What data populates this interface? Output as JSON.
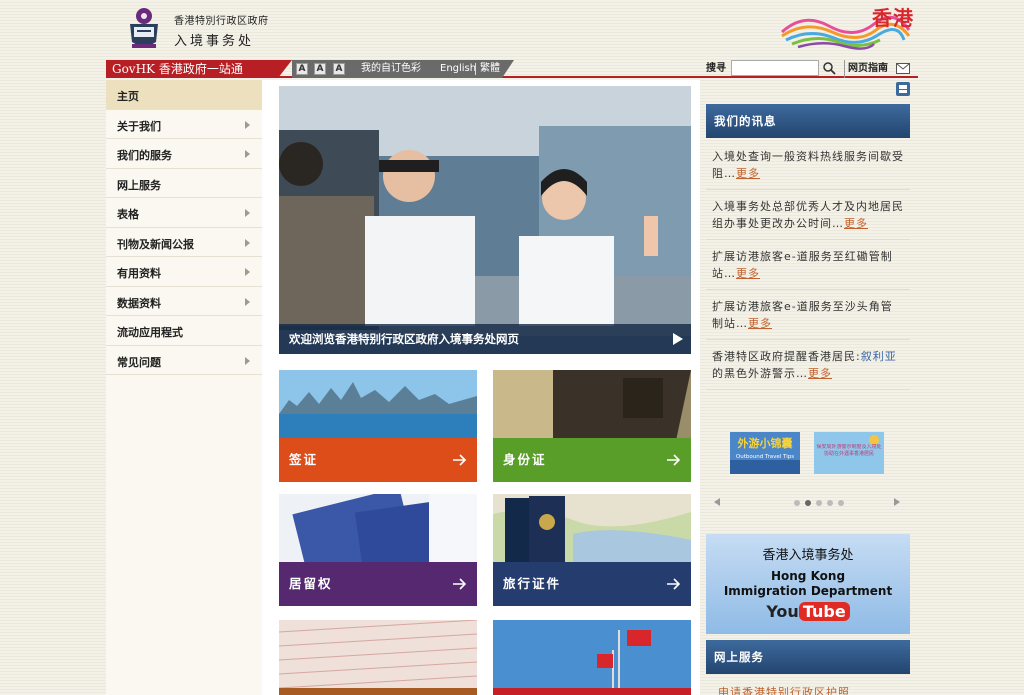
{
  "header": {
    "dept_line1": "香港特別行政区政府",
    "dept_line2": "入境事务处",
    "brand": "香港"
  },
  "toolbar": {
    "govhk": "GovHK 香港政府一站通",
    "font_sizes": [
      "A",
      "A",
      "A"
    ],
    "color_link": "我的自订色彩",
    "english": "English",
    "traditional": "繁體",
    "search_label": "搜寻",
    "search_value": "",
    "guide": "网页指南"
  },
  "sidebar": {
    "items": [
      {
        "label": "主页",
        "arrow": false,
        "active": true
      },
      {
        "label": "关于我们",
        "arrow": true
      },
      {
        "label": "我们的服务",
        "arrow": true
      },
      {
        "label": "网上服务",
        "arrow": false
      },
      {
        "label": "表格",
        "arrow": true
      },
      {
        "label": "刊物及新闻公报",
        "arrow": true
      },
      {
        "label": "有用资料",
        "arrow": true
      },
      {
        "label": "数据资料",
        "arrow": true
      },
      {
        "label": "流动应用程式",
        "arrow": false
      },
      {
        "label": "常见问题",
        "arrow": true
      }
    ]
  },
  "hero": {
    "caption": "欢迎浏览香港特别行政区政府入境事务处网页"
  },
  "tiles": [
    {
      "label": "签证",
      "color": "#dc4d1a"
    },
    {
      "label": "身份证",
      "color": "#5a9e2a"
    },
    {
      "label": "居留权",
      "color": "#55286f"
    },
    {
      "label": "旅行证件",
      "color": "#243c6e"
    }
  ],
  "news": {
    "title": "我们的讯息",
    "items": [
      {
        "text": "入境处查询一般资料热线服务间歇受阻…",
        "more": "更多"
      },
      {
        "text": "入境事务处总部优秀人才及内地居民组办事处更改办公时间…",
        "more": "更多"
      },
      {
        "text": "扩展访港旅客e-道服务至红磡管制站…",
        "more": "更多"
      },
      {
        "text": "扩展访港旅客e-道服务至沙头角管制站…",
        "more": "更多"
      },
      {
        "text_a": "香港特区政府提醒香港居民:",
        "text_hl": "叙利亚",
        "text_b": "的黑色外游警示…",
        "more": "更多"
      }
    ]
  },
  "promos": {
    "p1_text": "外游小锦囊",
    "p1_sub": "Outbound Travel Tips",
    "p2_text": "保安局外游警示制度及入境处协助在外遇事香港居民"
  },
  "youtube": {
    "line1": "香港入境事务处",
    "line2": "Hong Kong",
    "line3": "Immigration Department",
    "logo_you": "You",
    "logo_tube": "Tube"
  },
  "online": {
    "title": "网上服务",
    "link": "申请香港特别行政区护照"
  },
  "colors": {
    "accent_red": "#b71f25",
    "panel_blue": "#2f5584"
  }
}
